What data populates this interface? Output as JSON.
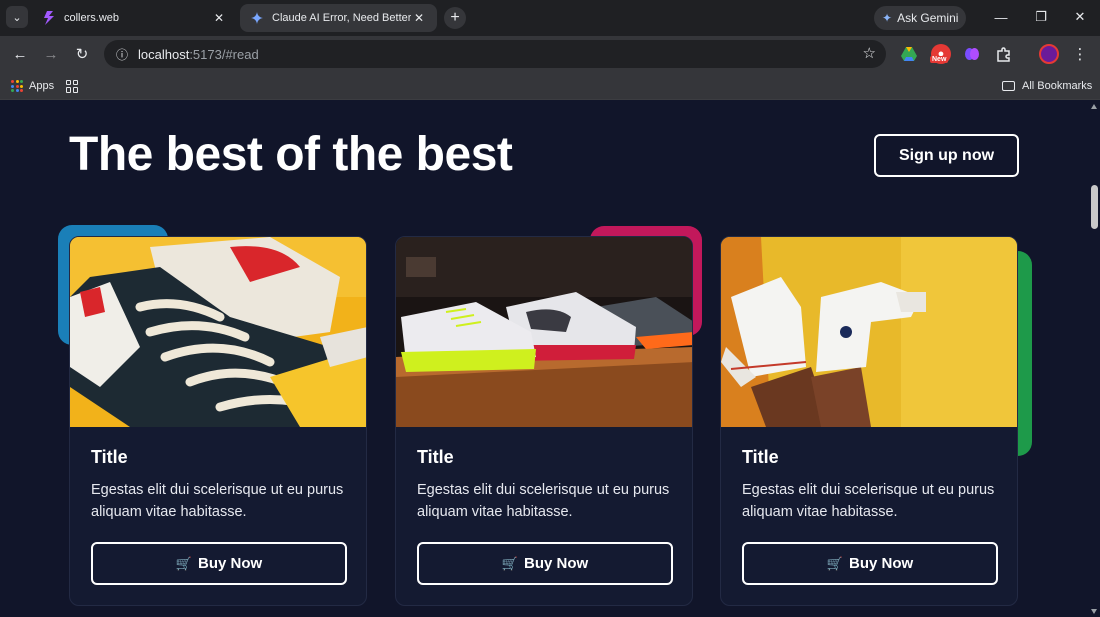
{
  "browser": {
    "tabs": [
      {
        "title": "collers.web",
        "active": false
      },
      {
        "title": "Claude AI Error, Need Better Co",
        "active": true
      }
    ],
    "ask_gemini_label": "Ask Gemini",
    "url_host": "localhost",
    "url_path": ":5173/#read",
    "extension_badge": "New",
    "bookmarks": {
      "apps_label": "Apps",
      "all_bookmarks_label": "All Bookmarks"
    }
  },
  "page": {
    "hero_title": "The best of the best",
    "signup_label": "Sign up now",
    "cards": [
      {
        "title": "Title",
        "text": "Egestas elit dui scelerisque ut eu purus aliquam vitae habitasse.",
        "button_label": "Buy Now",
        "image": "sneaker-closeup-yellow",
        "accent_color": "#1a7fb8"
      },
      {
        "title": "Title",
        "text": "Egestas elit dui scelerisque ut eu purus aliquam vitae habitasse.",
        "button_label": "Buy Now",
        "image": "sneakers-on-shelf",
        "accent_color": "#c2185b"
      },
      {
        "title": "Title",
        "text": "Egestas elit dui scelerisque ut eu purus aliquam vitae habitasse.",
        "button_label": "Buy Now",
        "image": "white-hightops-yellow-wall",
        "accent_color": "#1e9a4a"
      }
    ]
  },
  "colors": {
    "page_bg": "#11152a",
    "card_bg": "#141a31",
    "text": "#ffffff"
  }
}
